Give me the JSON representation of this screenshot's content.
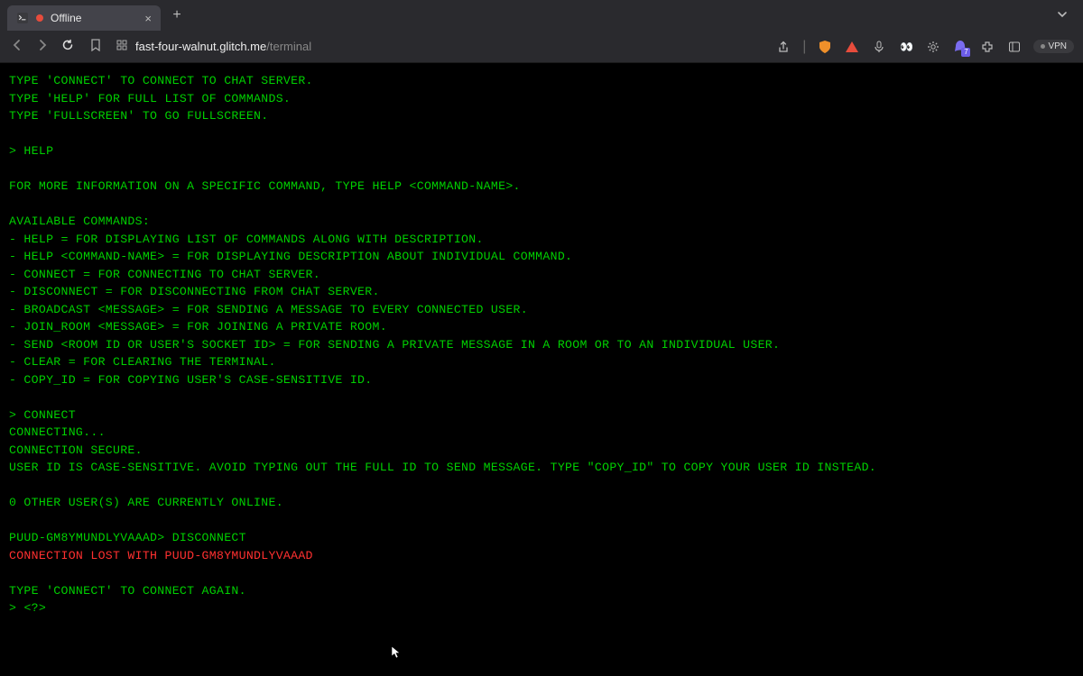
{
  "tab": {
    "title": "Offline",
    "status": "offline"
  },
  "url": {
    "domain": "fast-four-walnut.glitch.me",
    "path": "/terminal"
  },
  "vpn": {
    "label": "VPN"
  },
  "ext_badge": "7",
  "terminal": {
    "lines": [
      {
        "text": "TYPE 'CONNECT' TO CONNECT TO CHAT SERVER."
      },
      {
        "text": "TYPE 'HELP' FOR FULL LIST OF COMMANDS."
      },
      {
        "text": "TYPE 'FULLSCREEN' TO GO FULLSCREEN."
      },
      {
        "blank": true
      },
      {
        "text": "> HELP"
      },
      {
        "blank": true
      },
      {
        "text": "FOR MORE INFORMATION ON A SPECIFIC COMMAND, TYPE HELP <COMMAND-NAME>."
      },
      {
        "blank": true
      },
      {
        "text": "AVAILABLE COMMANDS:"
      },
      {
        "text": "- HELP = FOR DISPLAYING LIST OF COMMANDS ALONG WITH DESCRIPTION."
      },
      {
        "text": "- HELP <COMMAND-NAME> = FOR DISPLAYING DESCRIPTION ABOUT INDIVIDUAL COMMAND."
      },
      {
        "text": "- CONNECT = FOR CONNECTING TO CHAT SERVER."
      },
      {
        "text": "- DISCONNECT = FOR DISCONNECTING FROM CHAT SERVER."
      },
      {
        "text": "- BROADCAST <MESSAGE> = FOR SENDING A MESSAGE TO EVERY CONNECTED USER."
      },
      {
        "text": "- JOIN_ROOM <MESSAGE> = FOR JOINING A PRIVATE ROOM."
      },
      {
        "text": "- SEND <ROOM ID OR USER'S SOCKET ID> = FOR SENDING A PRIVATE MESSAGE IN A ROOM OR TO AN INDIVIDUAL USER."
      },
      {
        "text": "- CLEAR = FOR CLEARING THE TERMINAL."
      },
      {
        "text": "- COPY_ID = FOR COPYING USER'S CASE-SENSITIVE ID."
      },
      {
        "blank": true
      },
      {
        "text": "> CONNECT"
      },
      {
        "text": "CONNECTING..."
      },
      {
        "text": "CONNECTION SECURE."
      },
      {
        "text": "USER ID IS CASE-SENSITIVE. AVOID TYPING OUT THE FULL ID TO SEND MESSAGE. TYPE \"COPY_ID\" TO COPY YOUR USER ID INSTEAD."
      },
      {
        "blank": true
      },
      {
        "text": "0 OTHER USER(S) ARE CURRENTLY ONLINE."
      },
      {
        "blank": true
      },
      {
        "text": "PUUD-GM8YMUNDLYVAAAD> DISCONNECT"
      },
      {
        "text": "CONNECTION LOST WITH PUUD-GM8YMUNDLYVAAAD",
        "color": "red"
      },
      {
        "blank": true
      },
      {
        "text": "TYPE 'CONNECT' TO CONNECT AGAIN."
      }
    ],
    "prompt": "> ",
    "input_value": "<?>"
  }
}
